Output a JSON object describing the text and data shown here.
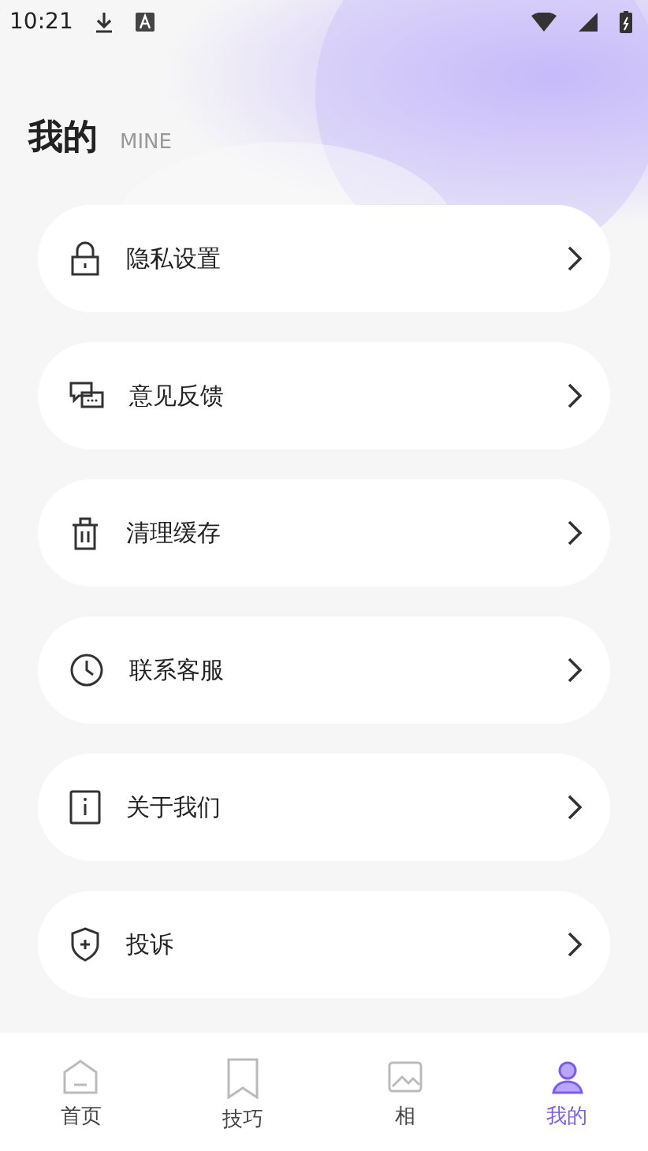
{
  "status_bar": {
    "time": "10:21"
  },
  "header": {
    "title": "我的",
    "subtitle": "MINE"
  },
  "menu": [
    {
      "kind": "lock",
      "label": "隐私设置"
    },
    {
      "kind": "chat",
      "label": "意见反馈"
    },
    {
      "kind": "trash",
      "label": "清理缓存"
    },
    {
      "kind": "clock",
      "label": "联系客服"
    },
    {
      "kind": "info",
      "label": "关于我们"
    },
    {
      "kind": "shield",
      "label": "投诉"
    }
  ],
  "tabs": [
    {
      "kind": "home",
      "label": "首页",
      "selected": false
    },
    {
      "kind": "bookmark",
      "label": "技巧",
      "selected": false
    },
    {
      "kind": "image",
      "label": "相",
      "selected": false
    },
    {
      "kind": "user",
      "label": "我的",
      "selected": true
    }
  ]
}
